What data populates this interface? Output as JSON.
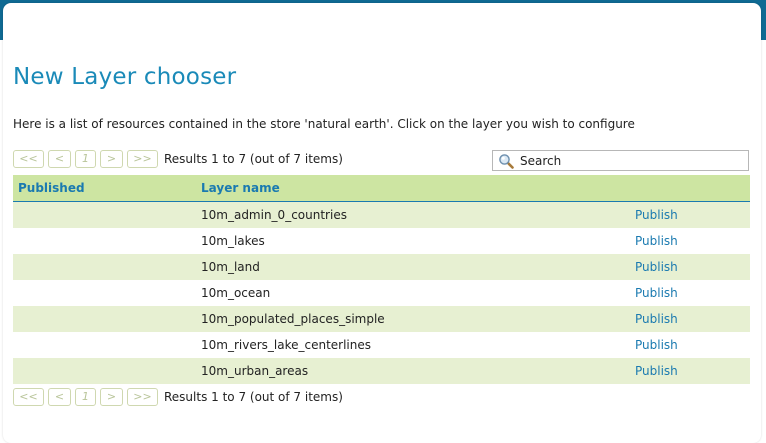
{
  "page": {
    "title": "New Layer chooser",
    "description": "Here is a list of resources contained in the store 'natural earth'. Click on the layer you wish to configure"
  },
  "pager": {
    "first": "<<",
    "prev": "<",
    "page": "1",
    "next": ">",
    "last": ">>",
    "results": "Results 1 to 7 (out of 7 items)"
  },
  "search": {
    "placeholder": "Search"
  },
  "table": {
    "headers": {
      "published": "Published",
      "layer_name": "Layer name",
      "action": ""
    },
    "rows": [
      {
        "published": "",
        "layer_name": "10m_admin_0_countries",
        "action": "Publish"
      },
      {
        "published": "",
        "layer_name": "10m_lakes",
        "action": "Publish"
      },
      {
        "published": "",
        "layer_name": "10m_land",
        "action": "Publish"
      },
      {
        "published": "",
        "layer_name": "10m_ocean",
        "action": "Publish"
      },
      {
        "published": "",
        "layer_name": "10m_populated_places_simple",
        "action": "Publish"
      },
      {
        "published": "",
        "layer_name": "10m_rivers_lake_centerlines",
        "action": "Publish"
      },
      {
        "published": "",
        "layer_name": "10m_urban_areas",
        "action": "Publish"
      }
    ]
  },
  "colors": {
    "header_bar": "#0f6a93",
    "title": "#1a8ab8",
    "table_header_bg": "#cde5a2",
    "row_alt_bg": "#e7f0d2",
    "link": "#1a7ab0"
  },
  "icons": {
    "search": "magnifier-icon"
  }
}
